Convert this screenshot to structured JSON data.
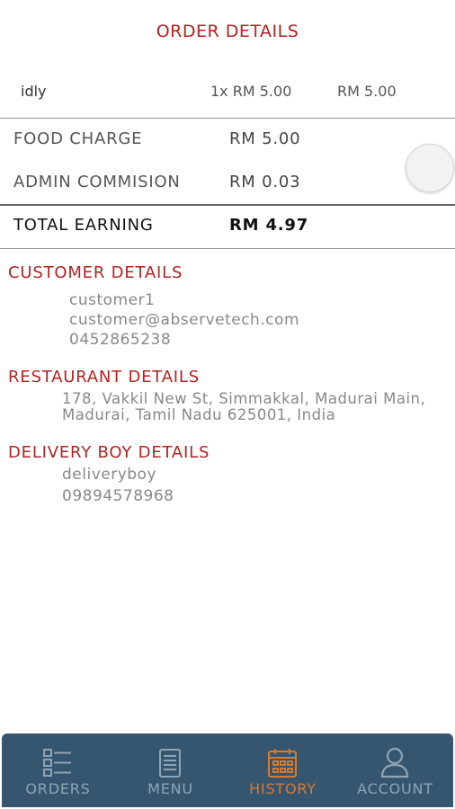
{
  "header": {
    "title": "ORDER DETAILS"
  },
  "items": [
    {
      "name": "idly",
      "qty": "1x RM 5.00",
      "price": "RM 5.00"
    }
  ],
  "summary": {
    "food_charge_label": "FOOD CHARGE",
    "food_charge_value": "RM 5.00",
    "admin_label": "ADMIN COMMISION",
    "admin_value": "RM 0.03",
    "total_label": "TOTAL EARNING",
    "total_value": "RM 4.97"
  },
  "customer": {
    "heading": "CUSTOMER DETAILS",
    "name": "customer1",
    "email": "customer@abservetech.com",
    "phone": "0452865238"
  },
  "restaurant": {
    "heading": "RESTAURANT DETAILS",
    "address_line1": "178, Vakkil New St, Simmakkal, Madurai Main,",
    "address_line2": "Madurai, Tamil Nadu 625001, India"
  },
  "delivery": {
    "heading": "DELIVERY BOY DETAILS",
    "name": "deliveryboy",
    "phone": "09894578968"
  },
  "nav": {
    "orders_label": "ORDERS",
    "menu_label": "MENU",
    "history_label": "HISTORY",
    "account_label": "ACCOUNT",
    "active": "history",
    "active_color": "#d97a2e",
    "bar_color": "#36566f"
  }
}
